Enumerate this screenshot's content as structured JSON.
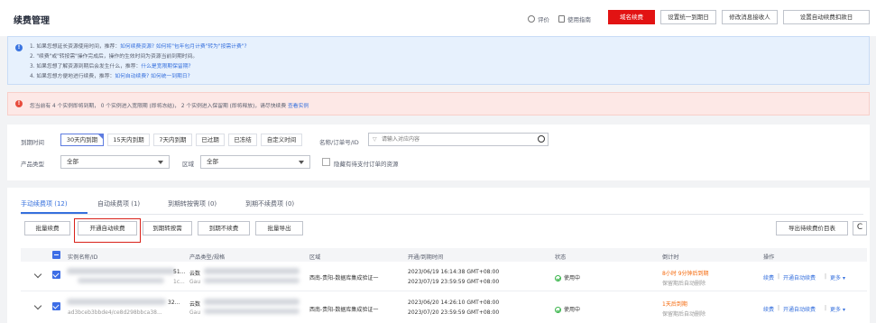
{
  "header": {
    "title": "续费管理",
    "links": {
      "feedback": "评价",
      "guide": "使用指南"
    },
    "buttons": {
      "domain_renew": "域名续费",
      "set_unified_expiry": "设置统一到期日",
      "modify_recipient": "修改消息接收人",
      "set_auto_renew_deduction": "设置自动续费扣款日"
    }
  },
  "info": {
    "line1_prefix": "1. 如果您想延长资源使用时间，推荐：",
    "line1_link1": "如何续费资源?",
    "line1_link2": "如何将\"包年包月计费\"转为\"按需计费\"?",
    "line2": "2. \"续费\"或\"转按需\"操作完成后，操作的生效时间为资源当前到期时间。",
    "line3_prefix": "3. 如果您想了解资源到期后会发生什么，推荐：",
    "line3_link": "什么是宽限期保留期?",
    "line4_prefix": "4. 如果您想方便地进行续费，推荐：",
    "line4_link1": "如何自动续费?",
    "line4_link2": "如何统一到期日?"
  },
  "warning": {
    "text": "您当前有 4 个实例即将到期， 0 个实例进入宽限期 (即将冻结)，  2 个实例进入保留期 (即将释放)，请尽快续费",
    "link": "查看实例"
  },
  "filters": {
    "expiry_label": "到期时间",
    "expiry_chips": [
      "30天内到期",
      "15天内到期",
      "7天内到期",
      "已过期",
      "已冻结",
      "自定义时间"
    ],
    "search_label": "名称/订单号/ID",
    "search_placeholder": "请输入对应内容",
    "product_type_label": "产品类型",
    "product_type_value": "全部",
    "region_label": "区域",
    "region_value": "全部",
    "hide_pending_label": "隐藏有待支付订单的资源"
  },
  "tabs": [
    "手动续费项 (12)",
    "自动续费项 (1)",
    "到期转按需项 (0)",
    "到期不续费项 (0)"
  ],
  "actions": {
    "batch_renew": "批量续费",
    "enable_auto_renew": "开通自动续费",
    "to_on_demand": "到期转按需",
    "no_renew": "到期不续费",
    "batch_export": "批量导出",
    "export_price_list": "导出待续费价目表",
    "refresh": "C"
  },
  "table": {
    "headers": [
      "实例名称/ID",
      "产品类型/规格",
      "区域",
      "开通/到期时间",
      "状态",
      "倒计时",
      "操作"
    ],
    "rows": [
      {
        "id_fragment_top": "51...",
        "id_fragment_bottom": "1c...",
        "product_top": "云数",
        "product_bottom": "Gau",
        "region": "西南-贵阳-数据库集成验证一",
        "start_time": "2023/06/19 16:14:38 GMT+08:00",
        "end_time": "2023/07/19 23:59:59 GMT+08:00",
        "status": "使用中",
        "countdown": "8小时 9分钟后到期",
        "countdown_note": "保留期后自动删除",
        "op_renew": "续费",
        "op_auto": "开通自动续费",
        "op_more": "更多"
      },
      {
        "id_fragment_top": "32...",
        "id_fragment_bottom": "ad3bceb3bbde4/ce8d298bbca38...",
        "product_top": "云数",
        "product_bottom": "Gau",
        "region": "西南-贵阳-数据库集成验证一",
        "start_time": "2023/06/20 14:26:10 GMT+08:00",
        "end_time": "2023/07/20 23:59:59 GMT+08:00",
        "status": "使用中",
        "countdown": "1天后到期",
        "countdown_note": "保留期后自动删除",
        "op_renew": "续费",
        "op_auto": "开通自动续费",
        "op_more": "更多"
      }
    ]
  },
  "colors": {
    "primary_red": "#e21313",
    "link_blue": "#3670dd",
    "info_bg": "#e7f1fd",
    "warn_bg": "#fde8e6",
    "status_green": "#39b54a",
    "countdown_orange": "#f5680a"
  }
}
